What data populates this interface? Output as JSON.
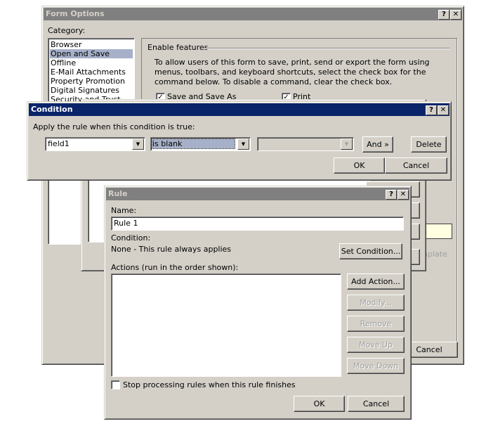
{
  "form_options": {
    "title": "Form Options",
    "category_label": "Category:",
    "categories": [
      "Browser",
      "Open and Save",
      "Offline",
      "E-Mail Attachments",
      "Property Promotion",
      "Digital Signatures",
      "Security and Trust"
    ],
    "selected_category": "Open and Save",
    "enable_features_label": "Enable features",
    "description": "To allow users of this form to save, print, send or export the form using menus, toolbars, and keyboard shortcuts, select the check box for the command below.  To disable a command, clear the check box.",
    "checkboxes": [
      {
        "label": "Save and Save As",
        "checked": true
      },
      {
        "label": "Print",
        "checked": true
      }
    ],
    "note_fragment": "s.",
    "template_fragment": "nplate",
    "cancel_label": "Cancel"
  },
  "condition": {
    "title": "Condition",
    "prompt": "Apply the rule when this condition is true:",
    "field_value": "field1",
    "operator_value": "is blank",
    "value_value": "",
    "and_label": "And »",
    "delete_label": "Delete",
    "ok_label": "OK",
    "cancel_label": "Cancel"
  },
  "rule": {
    "title": "Rule",
    "name_label": "Name:",
    "name_value": "Rule 1",
    "condition_label": "Condition:",
    "condition_value": "None - This rule always applies",
    "set_condition_label": "Set Condition...",
    "actions_label": "Actions (run in the order shown):",
    "add_action_label": "Add Action...",
    "modify_label": "Modify...",
    "remove_label": "Remove",
    "move_up_label": "Move Up",
    "move_down_label": "Move Down",
    "stop_processing_label": "Stop processing rules when this rule finishes",
    "stop_processing_checked": false,
    "ok_label": "OK",
    "cancel_label": "Cancel"
  },
  "colors": {
    "active_title": "#0a246a",
    "inactive_title": "#808080",
    "selection": "#a6b0c8",
    "face": "#d4d0c8"
  }
}
